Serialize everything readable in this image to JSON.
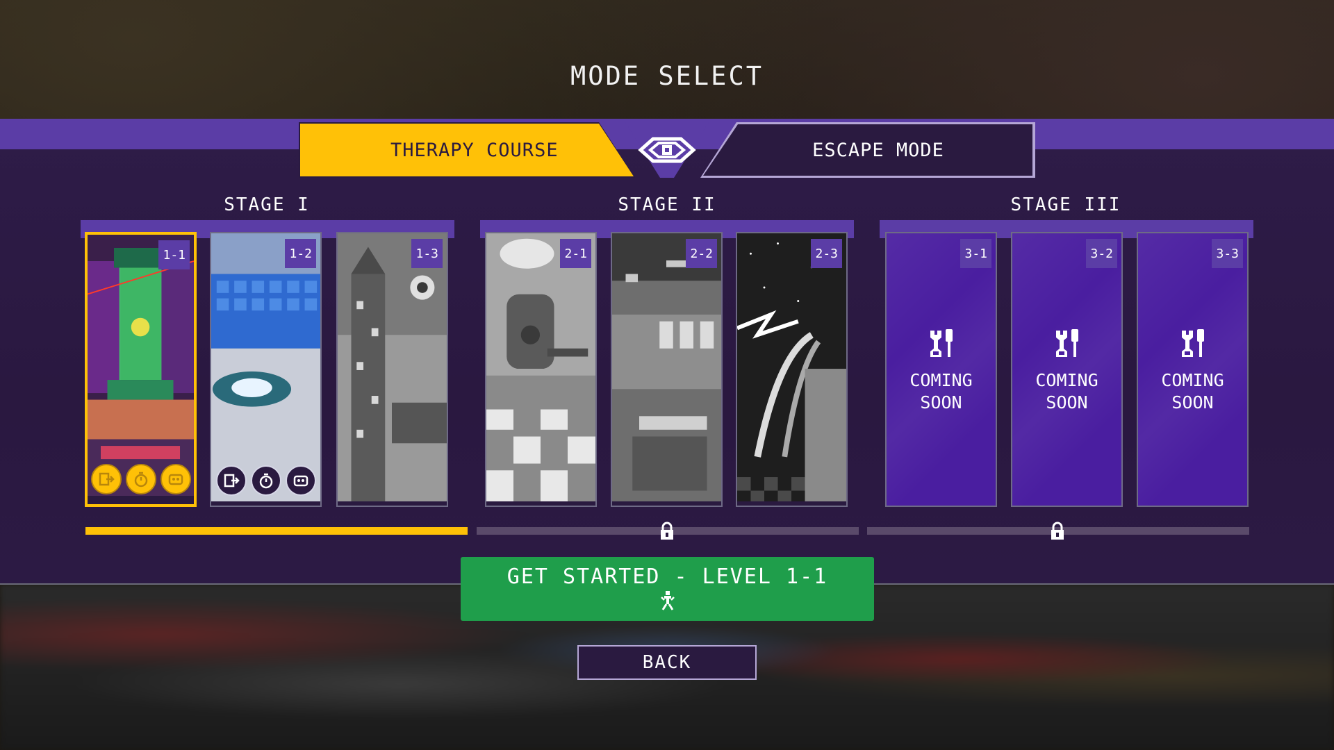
{
  "title": "MODE SELECT",
  "tabs": {
    "therapy": "THERAPY COURSE",
    "escape": "ESCAPE MODE"
  },
  "stages": [
    {
      "label": "STAGE I",
      "levels": [
        {
          "num": "1-1",
          "selected": true,
          "badges": "gold"
        },
        {
          "num": "1-2",
          "badges": "dark"
        },
        {
          "num": "1-3"
        }
      ],
      "progress": 1.0,
      "locked": false
    },
    {
      "label": "STAGE II",
      "levels": [
        {
          "num": "2-1"
        },
        {
          "num": "2-2"
        },
        {
          "num": "2-3"
        }
      ],
      "progress": 0.0,
      "locked": true
    },
    {
      "label": "STAGE III",
      "levels": [
        {
          "num": "3-1",
          "coming_soon": [
            "COMING",
            "SOON"
          ]
        },
        {
          "num": "3-2",
          "coming_soon": [
            "COMING",
            "SOON"
          ]
        },
        {
          "num": "3-3",
          "coming_soon": [
            "COMING",
            "SOON"
          ]
        }
      ],
      "progress": 0.0,
      "locked": true
    }
  ],
  "start_button": "GET STARTED - LEVEL 1-1",
  "back_button": "BACK",
  "colors": {
    "accent": "#ffc107",
    "panel": "#2a1a40",
    "stripe": "#5b3da6",
    "start": "#1f9e4b",
    "soon": "#4a1ea0"
  }
}
